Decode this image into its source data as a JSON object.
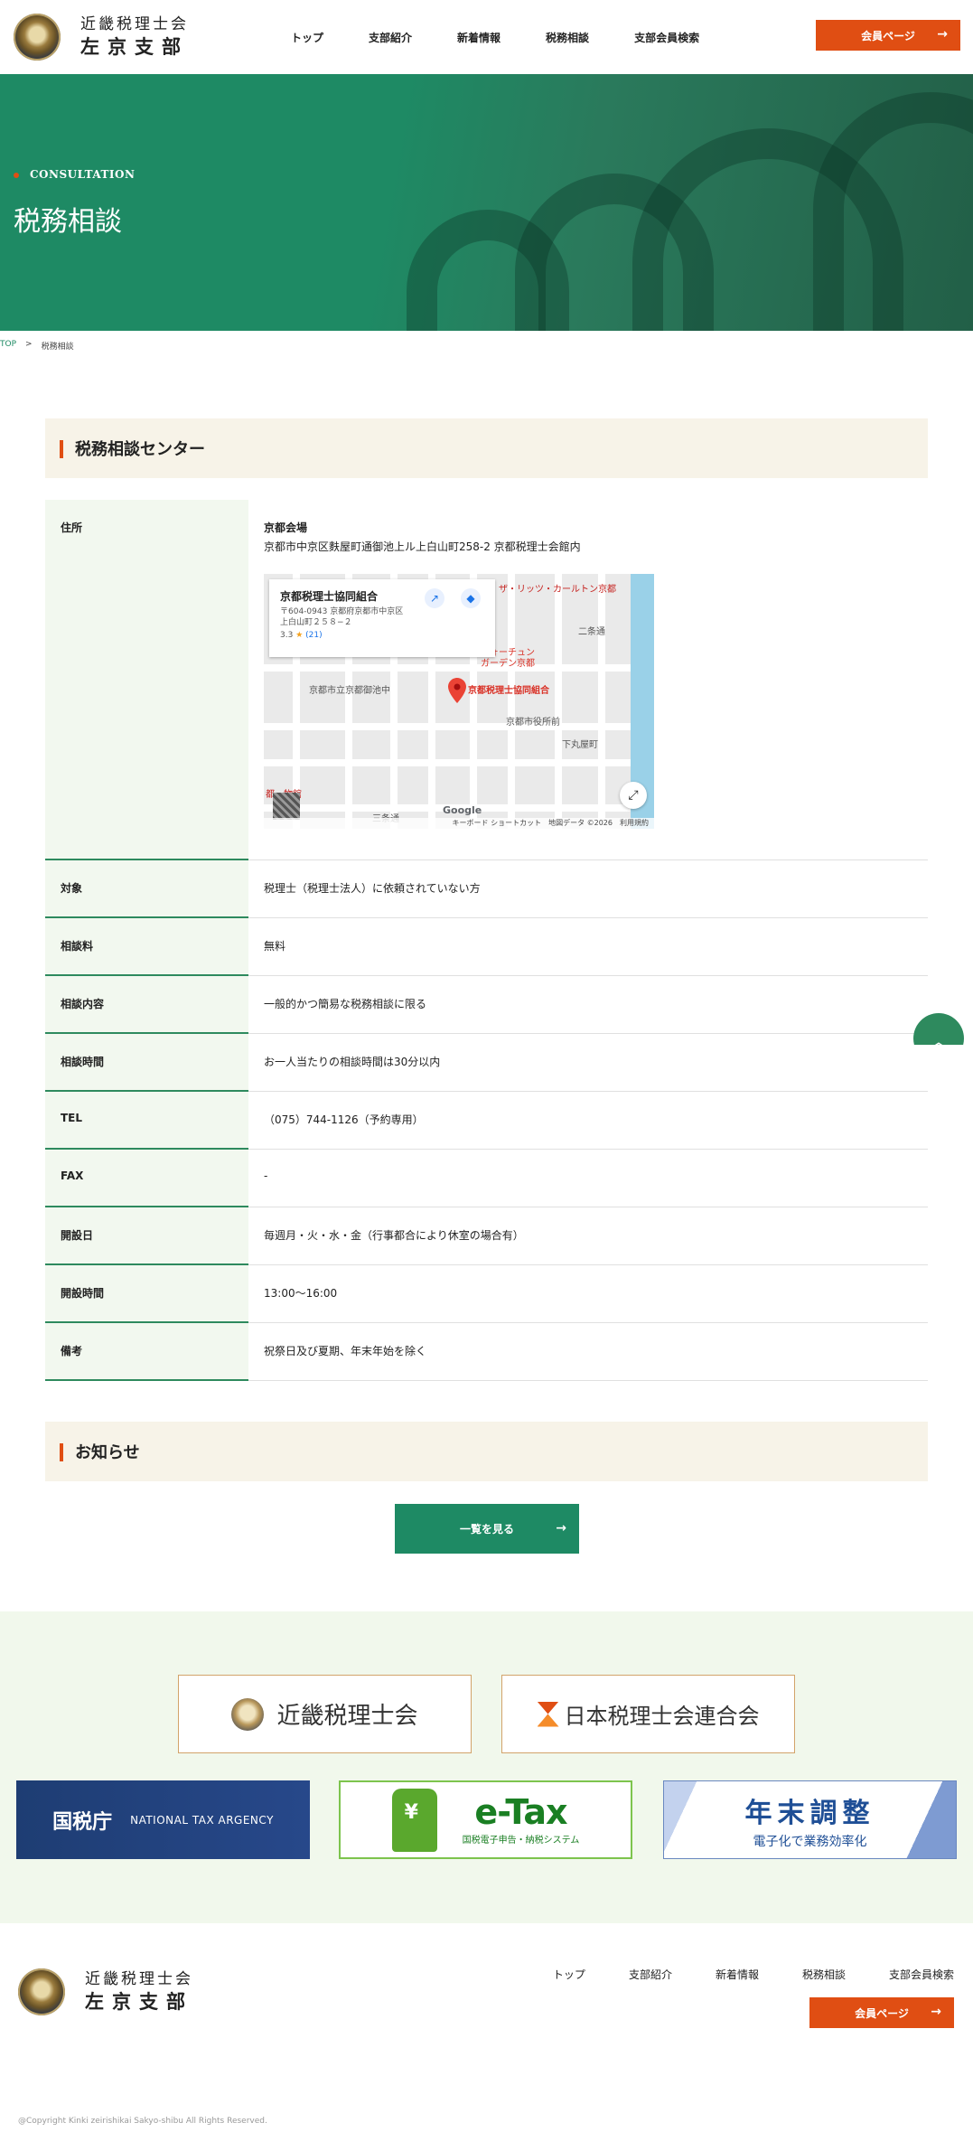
{
  "header": {
    "logo_line1": "近畿税理士会",
    "logo_line2": "左京支部",
    "nav": [
      "トップ",
      "支部紹介",
      "新着情報",
      "税務相談",
      "支部会員検索"
    ],
    "member_button": "会員ページ",
    "arrow": "→"
  },
  "hero": {
    "subtitle": "CONSULTATION",
    "title": "税務相談"
  },
  "breadcrumb": {
    "top": "TOP",
    "separator": ">",
    "current": "税務相談"
  },
  "consultation": {
    "section_title": "税務相談センター",
    "address_label": "住所",
    "venue_name": "京都会場",
    "venue_address": "京都市中京区麩屋町通御池上ル上白山町258-2 京都税理士会館内",
    "rows": [
      {
        "label": "対象",
        "value": "税理士（税理士法人）に依頼されていない方"
      },
      {
        "label": "相談料",
        "value": "無料"
      },
      {
        "label": "相談内容",
        "value": "一般的かつ簡易な税務相談に限る"
      },
      {
        "label": "相談時間",
        "value": "お一人当たりの相談時間は30分以内"
      },
      {
        "label": "TEL",
        "value": "（075）744-1126（予約専用）"
      },
      {
        "label": "FAX",
        "value": "-"
      },
      {
        "label": "開設日",
        "value": "毎週月・火・水・金（行事都合により休室の場合有）"
      },
      {
        "label": "開設時間",
        "value": "13:00〜16:00"
      },
      {
        "label": "備考",
        "value": "祝祭日及び夏期、年末年始を除く"
      }
    ]
  },
  "map": {
    "place_name": "京都税理士協同組合",
    "place_address_1": "〒604-0943 京都府京都市中京区",
    "place_address_2": "上白山町２５８−２",
    "rating": "3.3",
    "star": "★",
    "reviews": "(21)",
    "labels": {
      "hotel": "ザ・リッツ・カールトン京都",
      "nijo": "二条通",
      "fortune_1": "フォーチュン",
      "fortune_2": "ガーデン京都",
      "oike_school": "京都市立京都御池中",
      "place_red": "京都税理士協同組合",
      "city_hall": "京都市役所前",
      "shimomaruya": "下丸屋町",
      "museum": "都…物館",
      "sanjo": "三条通",
      "google": "Google",
      "map_footer": "キーボード ショートカット　地図データ ©2026　利用規約"
    }
  },
  "news": {
    "section_title": "お知らせ",
    "list_button": "一覧を見る"
  },
  "banners": {
    "kinki": "近畿税理士会",
    "nichizeiren": "日本税理士会連合会",
    "nta_ja": "国税庁",
    "nta_en": "NATIONAL TAX ARGENCY",
    "etax_main": "e-Tax",
    "etax_sub": "国税電子申告・納税システム",
    "nenmatsu_main": "年末調整",
    "nenmatsu_sub": "電子化で業務効率化"
  },
  "footer": {
    "copyright": "@Copyright Kinki zeirishikai Sakyo-shibu All Rights Reserved."
  },
  "colors": {
    "green": "#1e8a64",
    "orange": "#e04e13",
    "cream": "#f7f3e8"
  }
}
